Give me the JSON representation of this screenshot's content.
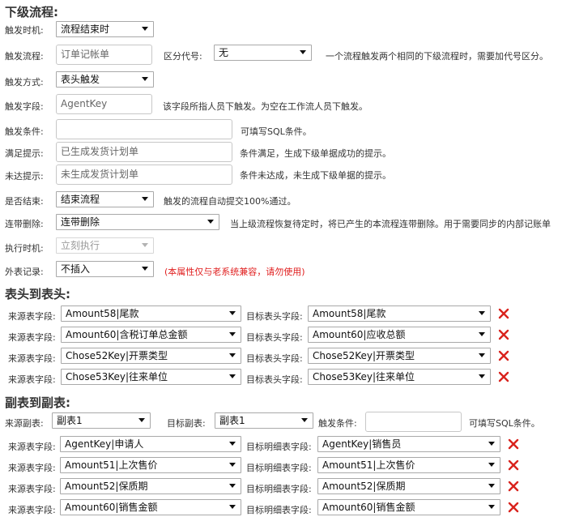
{
  "next_flow": {
    "title": "下级流程:",
    "trigger_time": {
      "label": "触发时机:",
      "value": "流程结束时"
    },
    "trigger_flow": {
      "label": "触发流程:",
      "value": "订单记帐单"
    },
    "distinguish_code": {
      "label": "区分代号:",
      "value": "无",
      "hint": "一个流程触发两个相同的下级流程时，需要加代号区分。"
    },
    "trigger_mode": {
      "label": "触发方式:",
      "value": "表头触发"
    },
    "trigger_field": {
      "label": "触发字段:",
      "value": "AgentKey",
      "hint": "该字段所指人员下触发。为空在工作流人员下触发。"
    },
    "trigger_condition": {
      "label": "触发条件:",
      "value": "",
      "hint": "可填写SQL条件。"
    },
    "satisfied_hint": {
      "label": "满足提示:",
      "value": "已生成发货计划单",
      "hint": "条件满足，生成下级单据成功的提示。"
    },
    "unsatisfied_hint": {
      "label": "未达提示:",
      "value": "未生成发货计划单",
      "hint": "条件未达成，未生成下级单据的提示。"
    },
    "is_end": {
      "label": "是否结束:",
      "value": "结束流程",
      "hint": "触发的流程自动提交100%通过。"
    },
    "cascade_delete": {
      "label": "连带删除:",
      "value": "连带删除",
      "hint": "当上级流程恢复待定时，将已产生的本流程连带删除。用于需要同步的内部记账单"
    },
    "exec_time": {
      "label": "执行时机:",
      "value": "立刻执行"
    },
    "external_record": {
      "label": "外表记录:",
      "value": "不插入",
      "warning": "(本属性仅与老系统兼容，请勿使用)"
    }
  },
  "header_to_header": {
    "title": "表头到表头:",
    "source_label": "来源表字段:",
    "target_label": "目标表头字段:",
    "rows": [
      {
        "source": "Amount58|尾款",
        "target": "Amount58|尾款"
      },
      {
        "source": "Amount60|含税订单总金额",
        "target": "Amount60|应收总额"
      },
      {
        "source": "Chose52Key|开票类型",
        "target": "Chose52Key|开票类型"
      },
      {
        "source": "Chose53Key|往来单位",
        "target": "Chose53Key|往来单位"
      }
    ]
  },
  "detail_to_detail": {
    "title": "副表到副表:",
    "source_table": {
      "label": "来源副表:",
      "value": "副表1"
    },
    "target_table": {
      "label": "目标副表:",
      "value": "副表1"
    },
    "condition": {
      "label": "触发条件:",
      "value": "",
      "hint": "可填写SQL条件。"
    },
    "source_label": "来源表字段:",
    "target_label": "目标明细表字段:",
    "rows": [
      {
        "source": "AgentKey|申请人",
        "target": "AgentKey|销售员"
      },
      {
        "source": "Amount51|上次售价",
        "target": "Amount51|上次售价"
      },
      {
        "source": "Amount52|保质期",
        "target": "Amount52|保质期"
      },
      {
        "source": "Amount60|销售金额",
        "target": "Amount60|销售金额"
      }
    ]
  },
  "icons": {
    "delete": "close-x-icon",
    "delete_color": "#d9231d"
  }
}
